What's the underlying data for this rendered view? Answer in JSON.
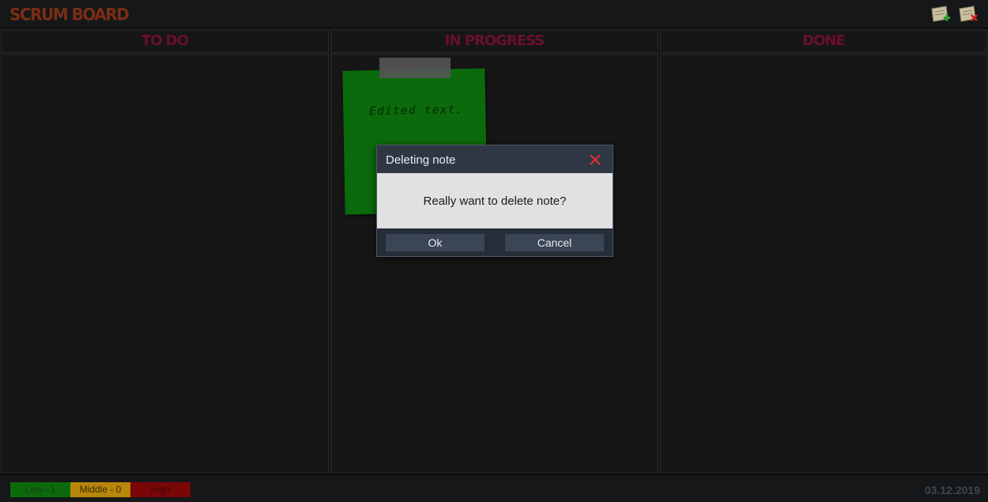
{
  "app": {
    "title": "SCRUM BOARD"
  },
  "toolbar": {
    "add_icon": "add-note-icon",
    "remove_icon": "remove-note-icon"
  },
  "columns": [
    {
      "label": "TO DO"
    },
    {
      "label": "IN PROGRESS"
    },
    {
      "label": "DONE"
    }
  ],
  "notes": [
    {
      "column": "IN PROGRESS",
      "text": "Edited text.",
      "color": "#0b6a0b"
    }
  ],
  "dialog": {
    "title": "Deleting note",
    "message": "Really want to delete note?",
    "ok_label": "Ok",
    "cancel_label": "Cancel",
    "close_icon": "close-icon"
  },
  "footer": {
    "priorities": [
      {
        "label": "Low - 1",
        "color": "#0c6a0c"
      },
      {
        "label": "Middle - 0",
        "color": "#b8860b"
      },
      {
        "label": "High",
        "color": "#7a0606"
      }
    ],
    "date": "03.12.2019"
  },
  "colors": {
    "title": "#7a2e12",
    "column_header": "#6a0f2a",
    "dialog_close": "#e03030"
  }
}
